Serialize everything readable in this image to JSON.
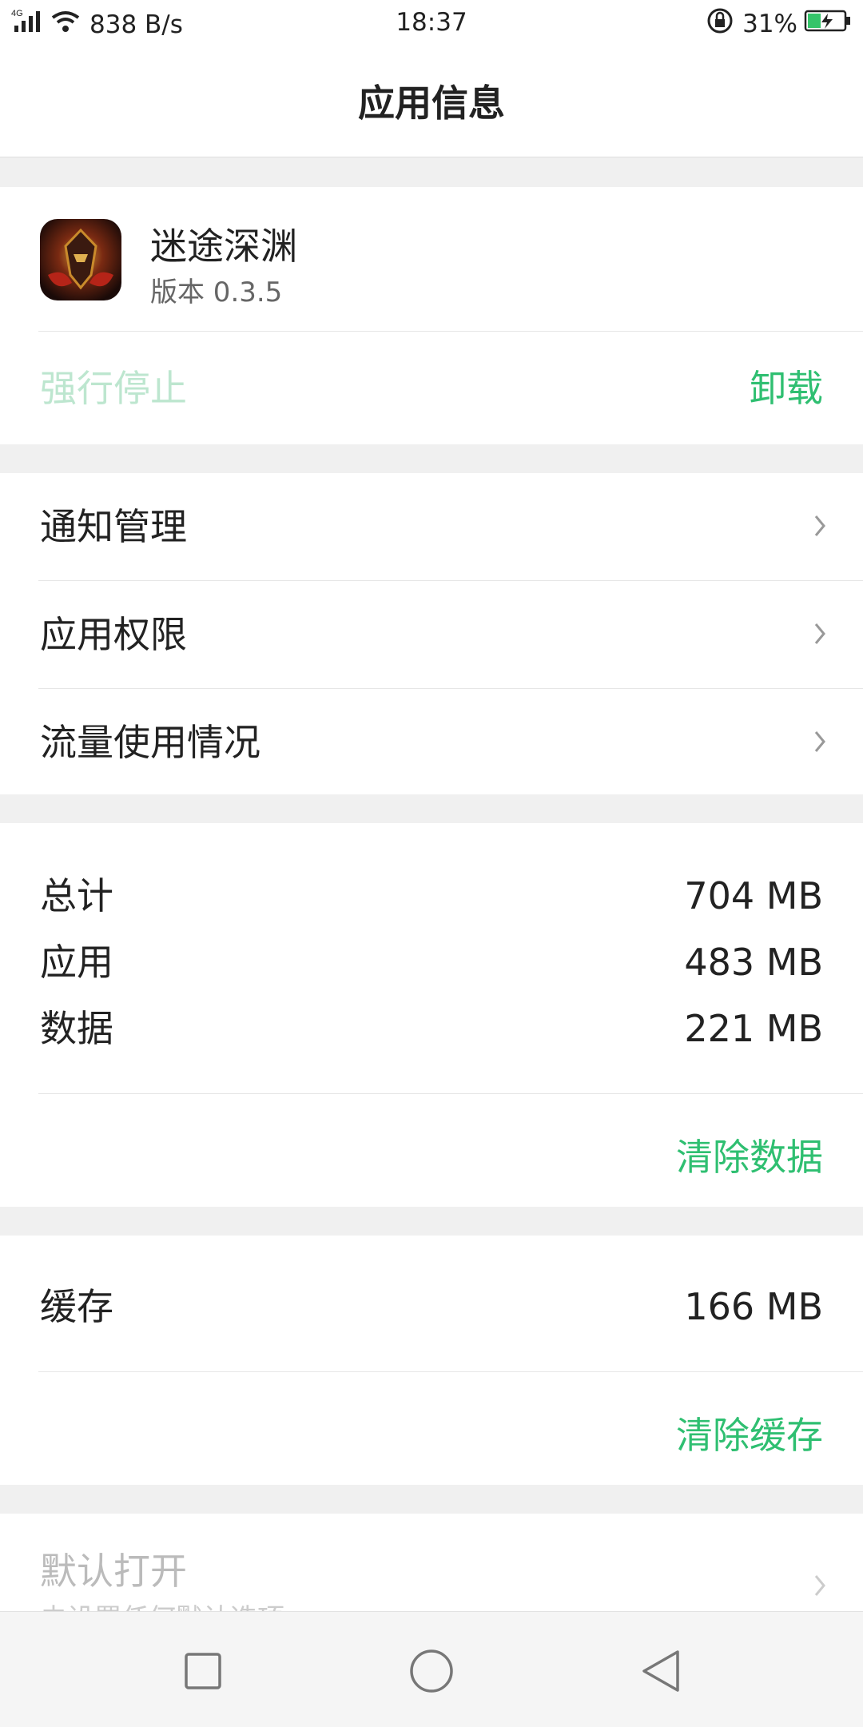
{
  "status_bar": {
    "network": "4G",
    "net_speed": "838 B/s",
    "time": "18:37",
    "battery": "31%"
  },
  "header": {
    "title": "应用信息"
  },
  "app": {
    "name": "迷途深渊",
    "version": "版本 0.3.5",
    "force_stop_label": "强行停止",
    "uninstall_label": "卸载"
  },
  "menu": {
    "items": [
      {
        "label": "通知管理",
        "icon": "chevron-right-icon"
      },
      {
        "label": "应用权限",
        "icon": "chevron-right-icon"
      },
      {
        "label": "流量使用情况",
        "icon": "chevron-right-icon"
      }
    ]
  },
  "storage": {
    "rows": [
      {
        "label": "总计",
        "value": "704 MB"
      },
      {
        "label": "应用",
        "value": "483 MB"
      },
      {
        "label": "数据",
        "value": "221 MB"
      }
    ],
    "clear_label": "清除数据"
  },
  "cache": {
    "label": "缓存",
    "value": "166 MB",
    "clear_label": "清除缓存"
  },
  "default_open": {
    "title": "默认打开",
    "subtitle": "未设置任何默认选项"
  },
  "colors": {
    "accent": "#2fbf71",
    "accent_disabled": "#bde6cf",
    "background": "#f0f0f0"
  }
}
